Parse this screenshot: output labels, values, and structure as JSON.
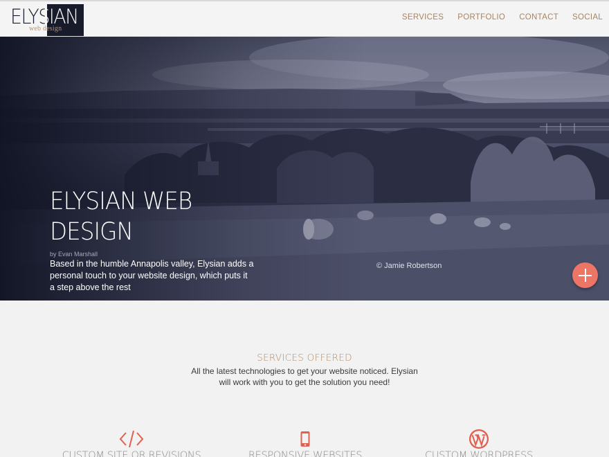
{
  "logo": {
    "text": "ELYSIAN",
    "subtitle": "web design"
  },
  "nav": {
    "items": [
      "SERVICES",
      "PORTFOLIO",
      "CONTACT",
      "SOCIAL"
    ]
  },
  "hero": {
    "title": "ELYSIAN WEB DESIGN",
    "byline": "by Evan Marshall",
    "description": "Based in the humble Annapolis valley, Elysian adds a personal touch to your website design, which puts it a step above the rest",
    "credit": "© Jamie Robertson",
    "fab_icon": "plus-icon"
  },
  "services": {
    "title": "SERVICES OFFERED",
    "description": "All the latest technologies to get your website noticed. Elysian will work with you to get the solution you need!",
    "items": [
      {
        "label": "CUSTOM SITE OR REVISIONS",
        "icon": "code-icon"
      },
      {
        "label": "RESPONSIVE WEBSITES",
        "icon": "mobile-icon"
      },
      {
        "label": "CUSTOM WORDPRESS",
        "icon": "wordpress-icon"
      }
    ]
  },
  "colors": {
    "accent": "#ec7566",
    "brand_gold": "#a68560",
    "hero_dark": "#171b2a"
  }
}
